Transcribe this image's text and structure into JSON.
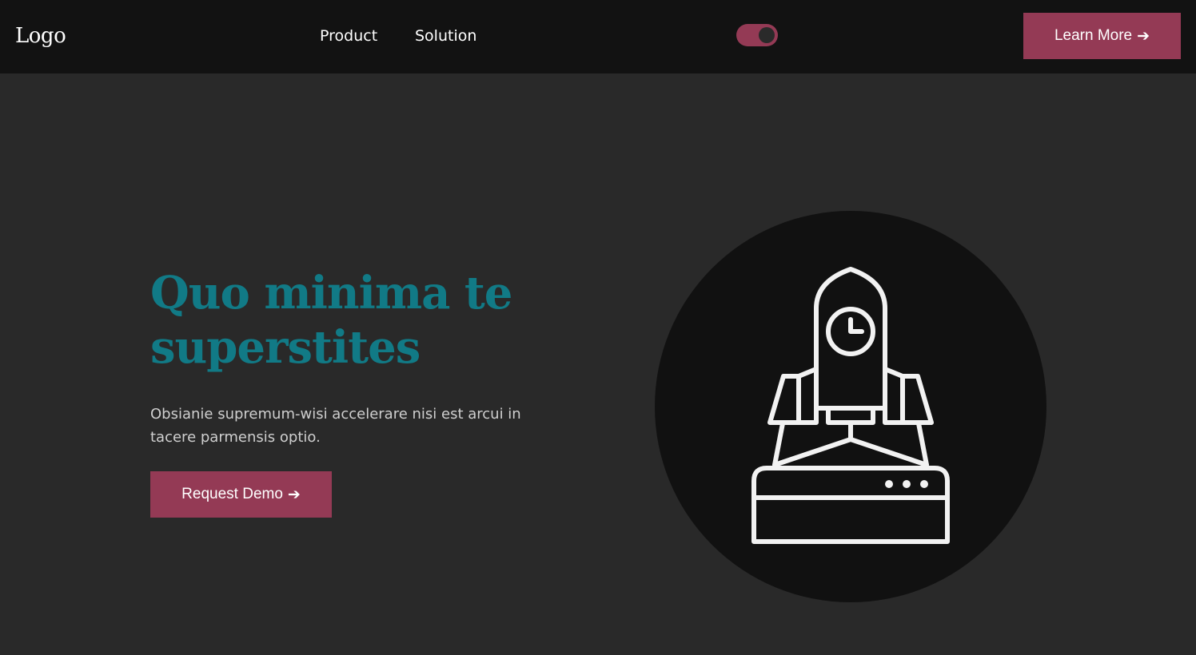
{
  "header": {
    "logo": "Logo",
    "nav": [
      {
        "label": "Product"
      },
      {
        "label": "Solution"
      }
    ],
    "theme_toggle": {
      "state": "on"
    },
    "cta": {
      "label": "Learn More",
      "arrow": "➔"
    }
  },
  "hero": {
    "headline": "Quo minima te superstites",
    "subtext": "Obsianie supremum-wisi accelerare nisi est arcui in tacere parmensis optio.",
    "cta": {
      "label": "Request Demo",
      "arrow": "➔"
    },
    "illustration": {
      "icon": "rocket-launch-icon"
    }
  },
  "colors": {
    "accent": "#943a55",
    "headline": "#117a86",
    "nav_bg": "#121212",
    "page_bg": "#292929",
    "circle_bg": "#111111",
    "text_light": "#cfcfcf"
  }
}
